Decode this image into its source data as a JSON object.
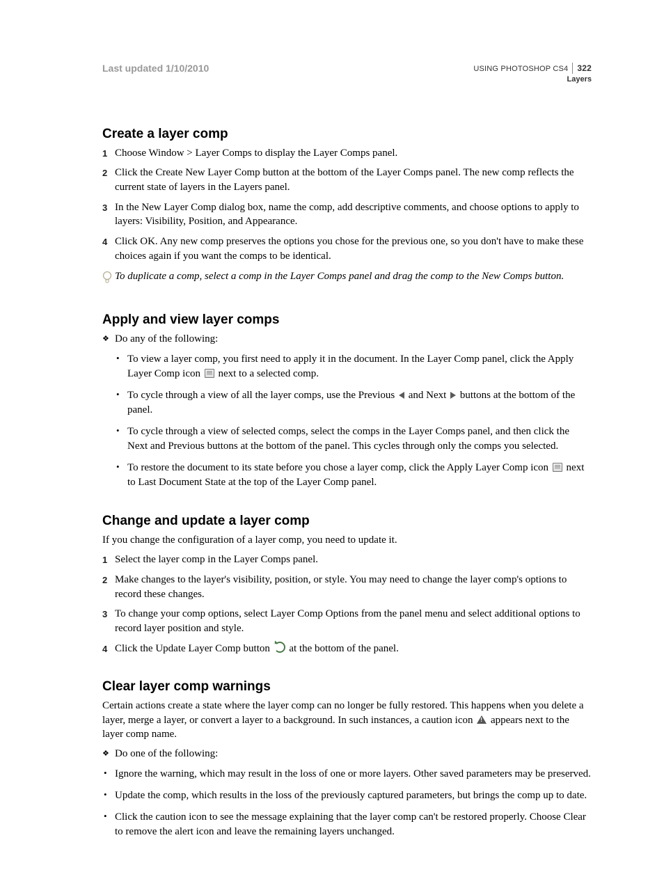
{
  "header": {
    "last_updated": "Last updated 1/10/2010",
    "doc_title": "USING PHOTOSHOP CS4",
    "section": "Layers",
    "page_num": "322"
  },
  "sections": {
    "create": {
      "heading": "Create a layer comp",
      "steps": [
        "Choose Window > Layer Comps to display the Layer Comps panel.",
        "Click the Create New Layer Comp button at the bottom of the Layer Comps panel. The new comp reflects the current state of layers in the Layers panel.",
        "In the New Layer Comp dialog box, name the comp, add descriptive comments, and choose options to apply to layers: Visibility, Position, and Appearance.",
        "Click OK. Any new comp preserves the options you chose for the previous one, so you don't have to make these choices again if you want the comps to be identical."
      ],
      "tip": "To duplicate a comp, select a comp in the Layer Comps panel and drag the comp to the New Comps button."
    },
    "apply": {
      "heading": "Apply and view layer comps",
      "do_label": "Do any of the following:",
      "bullets": {
        "b1a": "To view a layer comp, you first need to apply it in the document. In the Layer Comp panel, click the Apply Layer Comp icon ",
        "b1b": " next to a selected comp.",
        "b2a": "To cycle through a view of all the layer comps, use the Previous ",
        "b2b": " and Next ",
        "b2c": " buttons at the bottom of the panel.",
        "b3": "To cycle through a view of selected comps, select the comps in the Layer Comps panel, and then click the Next and Previous buttons at the bottom of the panel. This cycles through only the comps you selected.",
        "b4a": "To restore the document to its state before you chose a layer comp, click the Apply Layer Comp icon ",
        "b4b": " next to Last Document State at the top of the Layer Comp panel."
      }
    },
    "change": {
      "heading": "Change and update a layer comp",
      "lead": "If you change the configuration of a layer comp, you need to update it.",
      "steps": {
        "s1": "Select the layer comp in the Layer Comps panel.",
        "s2": "Make changes to the layer's visibility, position, or style. You may need to change the layer comp's options to record these changes.",
        "s3": "To change your comp options, select Layer Comp Options from the panel menu and select additional options to record layer position and style.",
        "s4a": "Click the Update Layer Comp button ",
        "s4b": " at the bottom of the panel."
      }
    },
    "clear": {
      "heading": "Clear layer comp warnings",
      "lead_a": "Certain actions create a state where the layer comp can no longer be fully restored. This happens when you delete a layer, merge a layer, or convert a layer to a background. In such instances, a caution icon ",
      "lead_b": " appears next to the layer comp name.",
      "do_label": "Do one of the following:",
      "bullets": [
        "Ignore the warning, which may result in the loss of one or more layers. Other saved parameters may be preserved.",
        "Update the comp, which results in the loss of the previously captured parameters, but brings the comp up to date.",
        "Click the caution icon to see the message explaining that the layer comp can't be restored properly. Choose Clear to remove the alert icon and leave the remaining layers unchanged."
      ]
    }
  }
}
